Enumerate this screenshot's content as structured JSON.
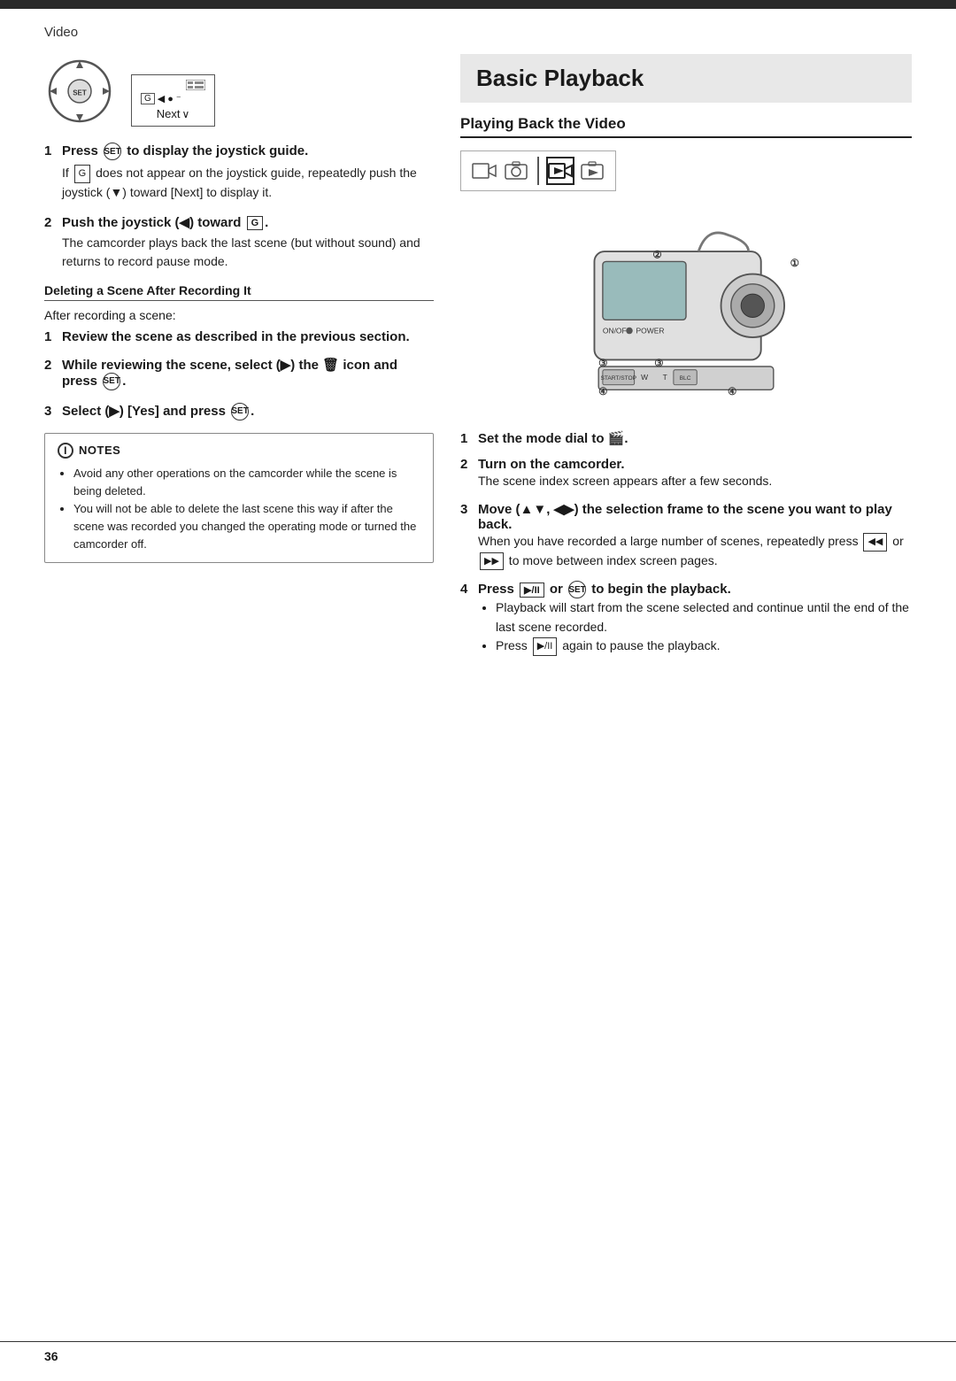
{
  "page": {
    "top_section": "Video",
    "page_number": "36"
  },
  "left": {
    "diagram": {
      "next_label": "Next"
    },
    "step1": {
      "number": "1",
      "title": "Press SET to display the joystick guide.",
      "body": "If G does not appear on the joystick guide, repeatedly push the joystick (▼) toward [Next] to display it."
    },
    "step2": {
      "number": "2",
      "title": "Push the joystick (◀) toward G.",
      "body": "The camcorder plays back the last scene (but without sound) and returns to record pause mode."
    },
    "deleting_subheading": "Deleting a Scene After Recording It",
    "after_recording": "After recording a scene:",
    "del_step1": {
      "number": "1",
      "title": "Review the scene as described in the previous section."
    },
    "del_step2": {
      "number": "2",
      "title": "While reviewing the scene, select (▶) the 🗑 icon and press SET."
    },
    "del_step3": {
      "number": "3",
      "title": "Select (▶) [Yes] and press SET."
    },
    "notes": {
      "header": "NOTES",
      "items": [
        "Avoid any other operations on the camcorder while the scene is being deleted.",
        "You will not be able to delete the last scene this way if after the scene was recorded you changed the operating mode or turned the camcorder off."
      ]
    }
  },
  "right": {
    "title": "Basic Playback",
    "subheading": "Playing Back the Video",
    "step1": {
      "number": "1",
      "title": "Set the mode dial to 🎬."
    },
    "step2": {
      "number": "2",
      "title": "Turn on the camcorder.",
      "body": "The scene index screen appears after a few seconds."
    },
    "step3": {
      "number": "3",
      "title": "Move (▲▼, ◀▶) the selection frame to the scene you want to play back.",
      "body": "When you have recorded a large number of scenes, repeatedly press ◀◀ or ▶▶ to move between index screen pages."
    },
    "step4": {
      "number": "4",
      "title": "Press ▶/II or SET to begin the playback.",
      "bullets": [
        "Playback will start from the scene selected and continue until the end of the last scene recorded.",
        "Press ▶/II again to pause the playback."
      ]
    }
  }
}
